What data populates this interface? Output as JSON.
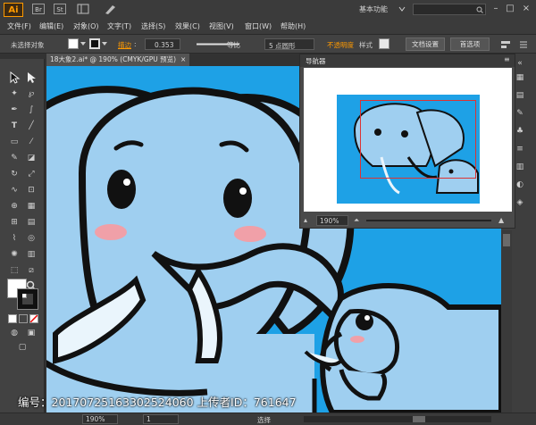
{
  "app": {
    "logo": "Ai",
    "title_icons": [
      "Br",
      "St"
    ],
    "workspace": "基本功能"
  },
  "menu": [
    "文件(F)",
    "编辑(E)",
    "对象(O)",
    "文字(T)",
    "选择(S)",
    "效果(C)",
    "视图(V)",
    "窗口(W)",
    "帮助(H)"
  ],
  "control": {
    "selection": "未选择对象",
    "stroke_label": "描边",
    "stroke_value": "0.353",
    "uniform": "等比",
    "brush": "5 点圆形",
    "opacity": "不透明度",
    "style": "样式",
    "doc_setup": "文档设置",
    "preferences": "首选项"
  },
  "document": {
    "tab": "18大象2.ai* @ 190% (CMYK/GPU 预览)",
    "close": "×"
  },
  "navigator": {
    "title": "导航器",
    "zoom": "190%"
  },
  "status": {
    "zoom": "190%",
    "page": "1",
    "tool": "选择"
  },
  "watermark": {
    "text": "编号：20170725163302524060 上传者ID：761647"
  },
  "colors": {
    "canvas_bg": "#1ea1e6",
    "elephant_body": "#9fcff0",
    "outline": "#111111",
    "tusk": "#eaf5fc",
    "cheek": "#f0a0a8",
    "accent": "#ff9a00"
  }
}
